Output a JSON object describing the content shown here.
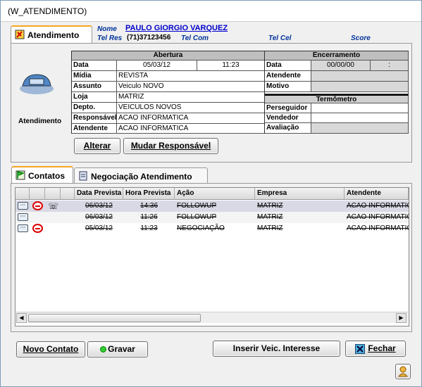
{
  "window": {
    "title": "(W_ATENDIMENTO)"
  },
  "tabs_top": [
    {
      "label": "Atendimento",
      "icon": "flag-icon"
    }
  ],
  "header": {
    "nome_label": "Nome",
    "nome_value": "PAULO GIORGIO VARQUEZ",
    "telres_label": "Tel Res",
    "telres_value": "(71)37123456",
    "telcom_label": "Tel Com",
    "telcel_label": "Tel Cel",
    "score_label": "Score"
  },
  "left_caption": "Atendimento",
  "abertura": {
    "title": "Abertura",
    "data_label": "Data",
    "data_value": "05/03/12",
    "hora_value": "11:23",
    "midia_label": "Mídia",
    "midia_value": "REVISTA",
    "assunto_label": "Assunto",
    "assunto_value": "Veiculo NOVO",
    "loja_label": "Loja",
    "loja_value": "MATRIZ",
    "depto_label": "Depto.",
    "depto_value": "VEICULOS NOVOS",
    "resp_label": "Responsável",
    "resp_value": "ACAO INFORMATICA",
    "atend_label": "Atendente",
    "atend_value": "ACAO INFORMATICA"
  },
  "encerramento": {
    "title": "Encerramento",
    "data_label": "Data",
    "data_value": "00/00/00",
    "hora_value": ":",
    "atend_label": "Atendente",
    "motivo_label": "Motivo",
    "termometro_title": "Termômetro",
    "perseguidor_label": "Perseguidor",
    "vendedor_label": "Vendedor",
    "avaliacao_label": "Avaliação"
  },
  "buttons": {
    "alterar": "Alterar",
    "mudar": "Mudar Responsável",
    "novo": "Novo Contato",
    "gravar": "Gravar",
    "inserir": "Inserir Veic. Interesse",
    "fechar": "Fechar"
  },
  "tabs_bottom": [
    {
      "label": "Contatos",
      "icon": "flag-icon"
    },
    {
      "label": "Negociação Atendimento",
      "icon": "document-icon"
    }
  ],
  "contacts": {
    "columns": [
      "",
      "",
      "",
      "",
      "Data Prevista",
      "Hora Prevista",
      "Ação",
      "Empresa",
      "Atendente"
    ],
    "rows": [
      {
        "data": "06/03/12",
        "hora": "14:36",
        "acao": "FOLLOWUP",
        "empresa": "MATRIZ",
        "atendente": "ACAO INFORMATICA",
        "selected": true,
        "icons": [
          "ellipsis-button",
          "no-entry-icon",
          "phone-icon"
        ]
      },
      {
        "data": "06/03/12",
        "hora": "11:26",
        "acao": "FOLLOWUP",
        "empresa": "MATRIZ",
        "atendente": "ACAO INFORMATICA",
        "selected": false,
        "icons": [
          "ellipsis-button"
        ]
      },
      {
        "data": "05/03/12",
        "hora": "11:23",
        "acao": "NEGOCIAÇÃO",
        "empresa": "MATRIZ",
        "atendente": "ACAO INFORMATICA",
        "selected": false,
        "icons": [
          "ellipsis-button",
          "no-entry-icon"
        ]
      }
    ]
  }
}
